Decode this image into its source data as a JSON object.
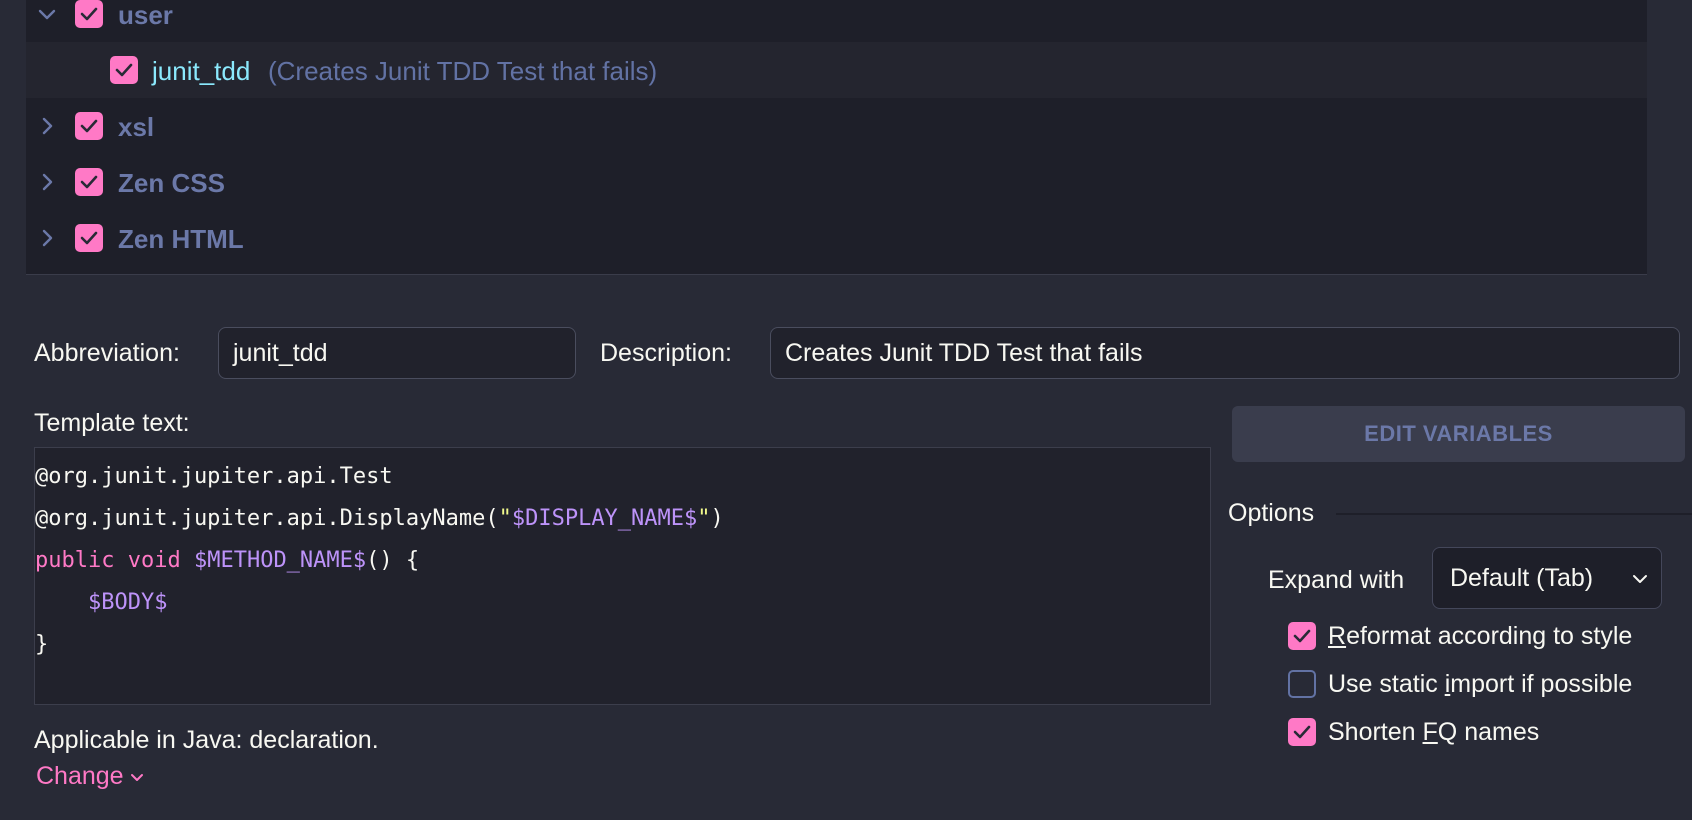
{
  "tree": {
    "groups": [
      {
        "name": "user",
        "expanded": true,
        "checked": true
      },
      {
        "name": "xsl",
        "expanded": false,
        "checked": true
      },
      {
        "name": "Zen CSS",
        "expanded": false,
        "checked": true
      },
      {
        "name": "Zen HTML",
        "expanded": false,
        "checked": true
      }
    ],
    "selected_template": {
      "name": "junit_tdd",
      "description": "(Creates Junit TDD Test that fails)",
      "checked": true
    }
  },
  "form": {
    "abbreviation_label": "Abbreviation:",
    "abbreviation_value": "junit_tdd",
    "description_label": "Description:",
    "description_value": "Creates Junit TDD Test that fails",
    "template_text_label": "Template text:"
  },
  "template_code": {
    "line1": "@org.junit.jupiter.api.Test",
    "line2_prefix": "@org.junit.jupiter.api.DisplayName(",
    "line2_quote_open": "\"",
    "line2_var": "$DISPLAY_NAME$",
    "line2_quote_close": "\"",
    "line2_suffix": ")",
    "line3_kw_public": "public",
    "line3_kw_void": "void",
    "line3_var": "$METHOD_NAME$",
    "line3_suffix": "() {",
    "line4_var": "$BODY$",
    "line5": "}"
  },
  "edit_variables_label": "EDIT VARIABLES",
  "options": {
    "title": "Options",
    "expand_with_label": "Expand with",
    "expand_with_value": "Default (Tab)",
    "reformat": {
      "label_pre": "",
      "label_u": "R",
      "label_post": "eformat according to style",
      "checked": true
    },
    "static_import": {
      "label_pre": "Use static ",
      "label_u": "i",
      "label_post": "mport if possible",
      "checked": false
    },
    "shorten_fq": {
      "label_pre": "Shorten ",
      "label_u": "F",
      "label_post": "Q names",
      "checked": true
    }
  },
  "applicable_text": "Applicable in Java: declaration.",
  "change_label": "Change",
  "colors": {
    "accent_pink": "#ff79c6",
    "purple_var": "#bd93f9",
    "cyan_name": "#8be9fd",
    "yellow_string": "#f1fa8c",
    "muted_blue": "#6272a4"
  }
}
